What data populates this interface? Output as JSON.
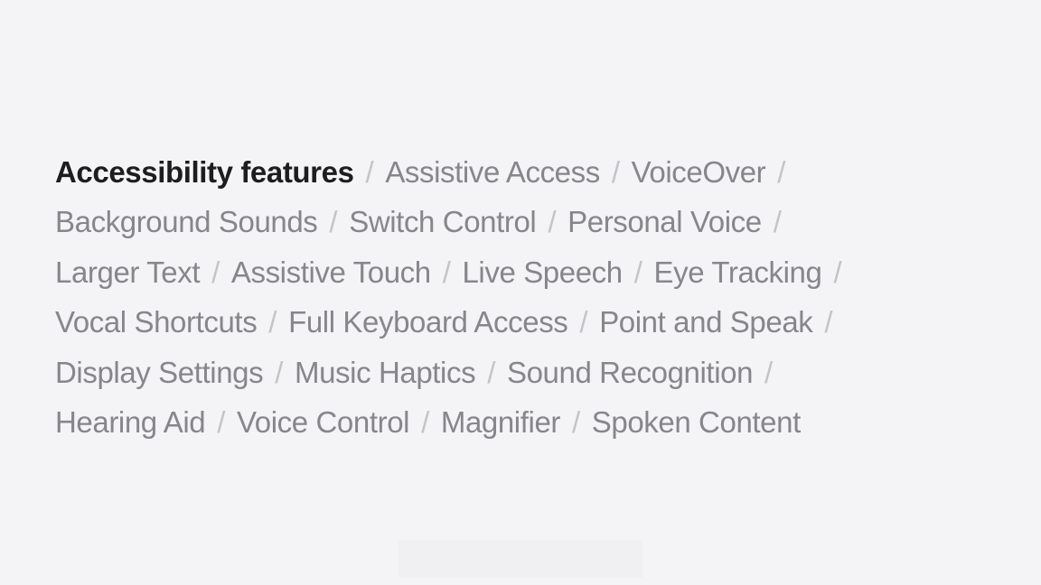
{
  "separator": "/",
  "heading": "Accessibility features",
  "lines": [
    [
      "Assistive Access",
      "VoiceOver"
    ],
    [
      "Background Sounds",
      "Switch Control",
      "Personal Voice"
    ],
    [
      "Larger Text",
      "Assistive Touch",
      "Live Speech",
      "Eye Tracking"
    ],
    [
      "Vocal Shortcuts",
      "Full Keyboard Access",
      "Point and Speak"
    ],
    [
      "Display Settings",
      "Music Haptics",
      "Sound Recognition"
    ],
    [
      "Hearing Aid",
      "Voice Control",
      "Magnifier",
      "Spoken Content"
    ]
  ],
  "colors": {
    "background": "#f4f4f6",
    "heading": "#1d1d1f",
    "item": "#86868b",
    "separator": "#c4c4c8"
  }
}
